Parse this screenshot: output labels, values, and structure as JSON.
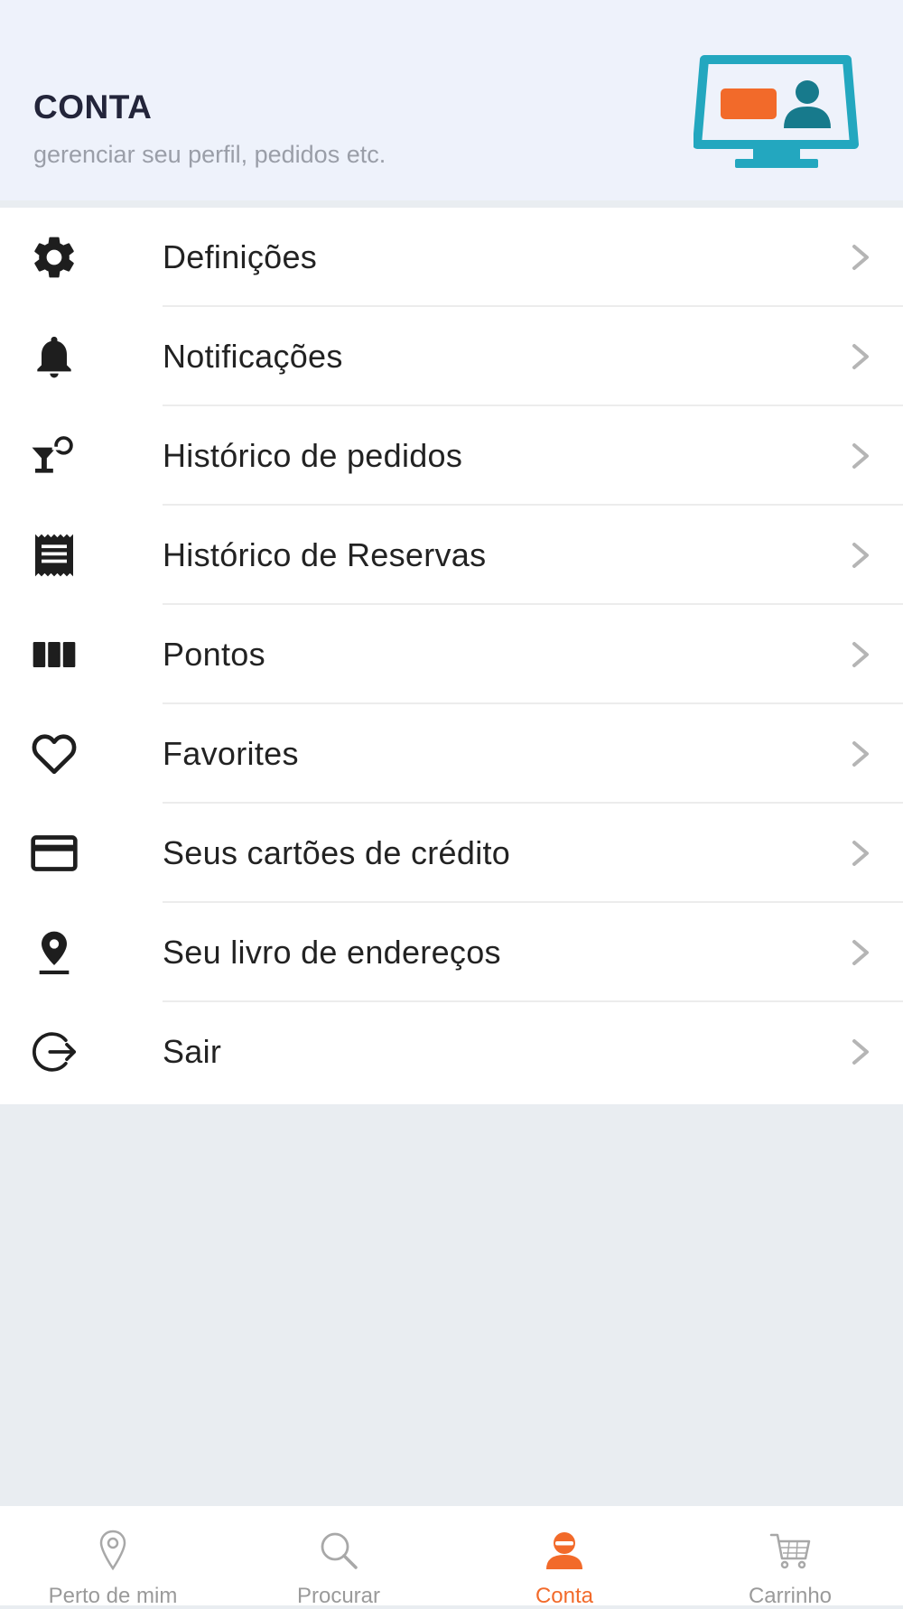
{
  "header": {
    "title": "CONTA",
    "subtitle": "gerenciar seu perfil, pedidos etc."
  },
  "menu": {
    "items": [
      {
        "label": "Definições",
        "icon": "gear-icon"
      },
      {
        "label": "Notificações",
        "icon": "bell-icon"
      },
      {
        "label": "Histórico de pedidos",
        "icon": "cocktail-icon"
      },
      {
        "label": "Histórico de Reservas",
        "icon": "receipt-icon"
      },
      {
        "label": "Pontos",
        "icon": "columns-icon"
      },
      {
        "label": "Favorites",
        "icon": "heart-icon"
      },
      {
        "label": "Seus cartões de crédito",
        "icon": "credit-card-icon"
      },
      {
        "label": "Seu livro de endereços",
        "icon": "location-pin-icon"
      },
      {
        "label": "Sair",
        "icon": "logout-icon"
      }
    ]
  },
  "tabbar": {
    "tabs": [
      {
        "label": "Perto de mim",
        "icon": "map-pin-icon",
        "active": false
      },
      {
        "label": "Procurar",
        "icon": "search-icon",
        "active": false
      },
      {
        "label": "Conta",
        "icon": "user-icon",
        "active": true
      },
      {
        "label": "Carrinho",
        "icon": "cart-icon",
        "active": false
      }
    ]
  },
  "colors": {
    "accent": "#f26a2a",
    "header_bg": "#eef2fb",
    "page_bg": "#e9edf1",
    "illustration_teal": "#23a7bf",
    "illustration_dark_teal": "#177a8c",
    "illustration_orange": "#f26a2a"
  }
}
